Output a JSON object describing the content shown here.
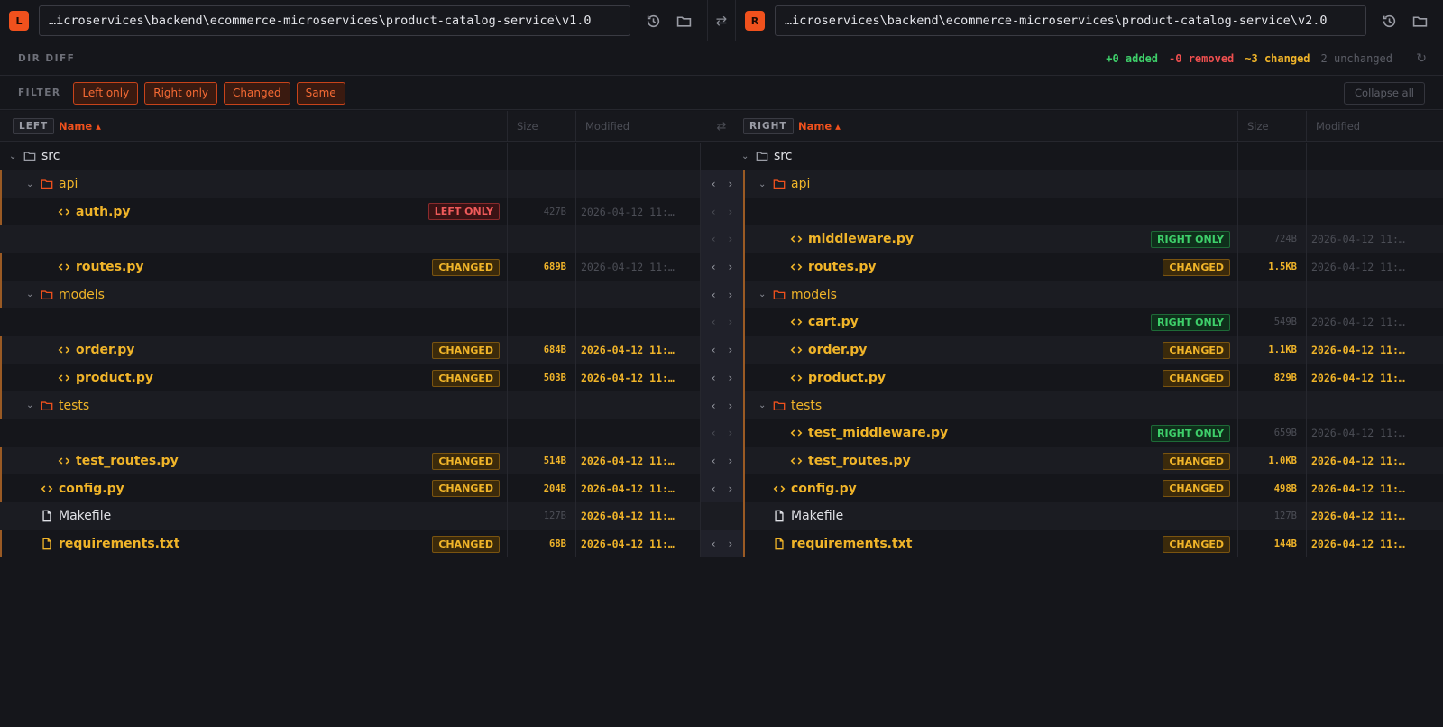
{
  "left": {
    "badge": "L",
    "path": "…icroservices\\backend\\ecommerce-microservices\\product-catalog-service\\v1.0",
    "tag": "LEFT"
  },
  "right": {
    "badge": "R",
    "path": "…icroservices\\backend\\ecommerce-microservices\\product-catalog-service\\v2.0",
    "tag": "RIGHT"
  },
  "summary": {
    "label": "DIR DIFF",
    "added": "+0 added",
    "removed": "-0 removed",
    "changed": "~3 changed",
    "unchanged": "2 unchanged"
  },
  "filter": {
    "label": "FILTER",
    "chips": [
      "Left only",
      "Right only",
      "Changed",
      "Same"
    ],
    "collapse": "Collapse all"
  },
  "columns": {
    "name": "Name ▴",
    "size": "Size",
    "modified": "Modified"
  },
  "colors": {
    "accent": "#f0511d",
    "changed": "#f0b429",
    "added": "#3ecf6a",
    "removed": "#ef4f4f"
  },
  "rows": [
    {
      "l": {
        "name": "src",
        "kind": "dir"
      },
      "r": {
        "name": "src",
        "kind": "dir"
      }
    },
    {
      "l": {
        "name": "api",
        "kind": "dir-changed"
      },
      "r": {
        "name": "api",
        "kind": "dir-changed"
      }
    },
    {
      "l": {
        "name": "auth.py",
        "kind": "code",
        "badge": "LEFT ONLY",
        "size": "427B",
        "mod": "2026-04-12 11:…"
      },
      "r": null
    },
    {
      "l": null,
      "r": {
        "name": "middleware.py",
        "kind": "code",
        "badge": "RIGHT ONLY",
        "size": "724B",
        "mod": "2026-04-12 11:…"
      }
    },
    {
      "l": {
        "name": "routes.py",
        "kind": "code",
        "badge": "CHANGED",
        "size": "689B",
        "mod": "2026-04-12 11:…"
      },
      "r": {
        "name": "routes.py",
        "kind": "code",
        "badge": "CHANGED",
        "size": "1.5KB",
        "mod": "2026-04-12 11:…"
      }
    },
    {
      "l": {
        "name": "models",
        "kind": "dir-changed"
      },
      "r": {
        "name": "models",
        "kind": "dir-changed"
      }
    },
    {
      "l": null,
      "r": {
        "name": "cart.py",
        "kind": "code",
        "badge": "RIGHT ONLY",
        "size": "549B",
        "mod": "2026-04-12 11:…"
      }
    },
    {
      "l": {
        "name": "order.py",
        "kind": "code",
        "badge": "CHANGED",
        "size": "684B",
        "mod": "2026-04-12 11:…"
      },
      "r": {
        "name": "order.py",
        "kind": "code",
        "badge": "CHANGED",
        "size": "1.1KB",
        "mod": "2026-04-12 11:…"
      }
    },
    {
      "l": {
        "name": "product.py",
        "kind": "code",
        "badge": "CHANGED",
        "size": "503B",
        "mod": "2026-04-12 11:…"
      },
      "r": {
        "name": "product.py",
        "kind": "code",
        "badge": "CHANGED",
        "size": "829B",
        "mod": "2026-04-12 11:…"
      }
    },
    {
      "l": {
        "name": "tests",
        "kind": "dir-changed"
      },
      "r": {
        "name": "tests",
        "kind": "dir-changed"
      }
    },
    {
      "l": null,
      "r": {
        "name": "test_middleware.py",
        "kind": "code",
        "badge": "RIGHT ONLY",
        "size": "659B",
        "mod": "2026-04-12 11:…"
      }
    },
    {
      "l": {
        "name": "test_routes.py",
        "kind": "code",
        "badge": "CHANGED",
        "size": "514B",
        "mod": "2026-04-12 11:…"
      },
      "r": {
        "name": "test_routes.py",
        "kind": "code",
        "badge": "CHANGED",
        "size": "1.0KB",
        "mod": "2026-04-12 11:…"
      }
    },
    {
      "l": {
        "name": "config.py",
        "kind": "code",
        "badge": "CHANGED",
        "size": "204B",
        "mod": "2026-04-12 11:…"
      },
      "r": {
        "name": "config.py",
        "kind": "code",
        "badge": "CHANGED",
        "size": "498B",
        "mod": "2026-04-12 11:…"
      }
    },
    {
      "l": {
        "name": "Makefile",
        "kind": "plain",
        "size": "127B",
        "mod": "2026-04-12 11:…"
      },
      "r": {
        "name": "Makefile",
        "kind": "plain",
        "size": "127B",
        "mod": "2026-04-12 11:…"
      }
    },
    {
      "l": {
        "name": "requirements.txt",
        "kind": "text",
        "badge": "CHANGED",
        "size": "68B",
        "mod": "2026-04-12 11:…"
      },
      "r": {
        "name": "requirements.txt",
        "kind": "text",
        "badge": "CHANGED",
        "size": "144B",
        "mod": "2026-04-12 11:…"
      }
    }
  ]
}
